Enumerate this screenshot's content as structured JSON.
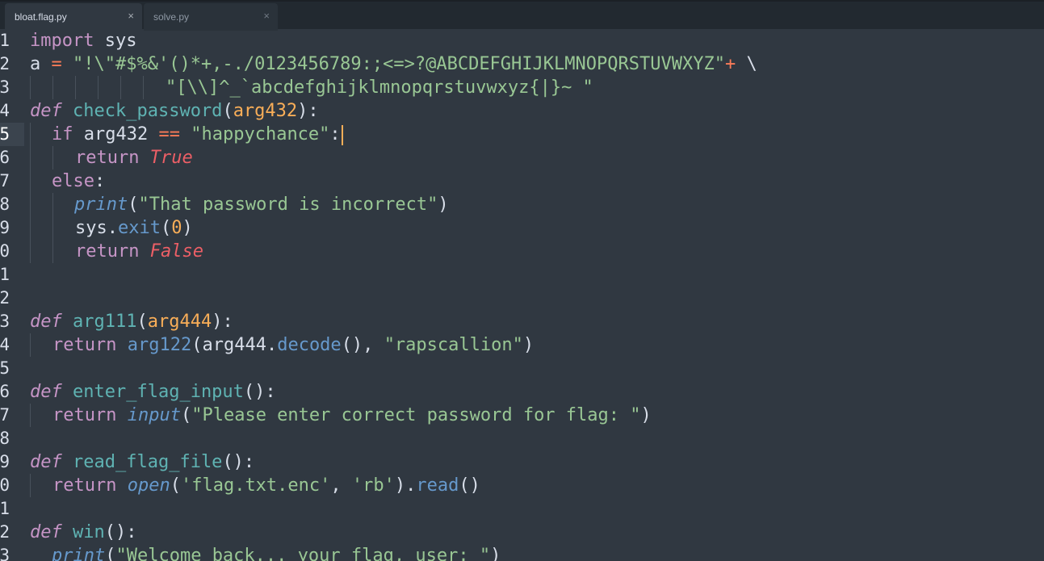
{
  "tabs": [
    {
      "label": "bloat.flag.py",
      "close": "×",
      "active": true
    },
    {
      "label": "solve.py",
      "close": "×",
      "active": false
    }
  ],
  "gutter": [
    "1",
    "2",
    "3",
    "4",
    "5",
    "6",
    "7",
    "8",
    "9",
    "0",
    "1",
    "2",
    "3",
    "4",
    "5",
    "6",
    "7",
    "8",
    "9",
    "0",
    "1",
    "2",
    "3"
  ],
  "code": {
    "l1": {
      "kw": "import",
      "rest": " sys"
    },
    "l2": {
      "a": "a",
      "eq": "=",
      "str": "\"!\\\"#$%&'()*+,-./0123456789:;<=>?@ABCDEFGHIJKLMNOPQRSTUVWXYZ\"",
      "plus": "+",
      "cont": "\\"
    },
    "l3": {
      "str": "\"[\\\\]^_`abcdefghijklmnopqrstuvwxyz{|}~ \""
    },
    "l4": {
      "def": "def",
      "name": "check_password",
      "open": "(",
      "param": "arg432",
      "close": "):"
    },
    "l5": {
      "kw": "if",
      "var": "arg432",
      "op": "==",
      "str": "\"happychance\"",
      "colon": ":"
    },
    "l6": {
      "kw": "return",
      "val": "True"
    },
    "l7": {
      "kw": "else",
      "colon": ":"
    },
    "l8": {
      "fn": "print",
      "open": "(",
      "str": "\"That password is incorrect\"",
      "close": ")"
    },
    "l9": {
      "obj": "sys",
      "dot": ".",
      "method": "exit",
      "open": "(",
      "num": "0",
      "close": ")"
    },
    "l10": {
      "kw": "return",
      "val": "False"
    },
    "l12": {
      "def": "def",
      "name": "arg111",
      "open": "(",
      "param": "arg444",
      "close": "):"
    },
    "l13": {
      "kw": "return",
      "fn": "arg122",
      "open": "(",
      "var": "arg444",
      "dot": ".",
      "method": "decode",
      "call": "(),",
      "str": "\"rapscallion\"",
      "close": ")"
    },
    "l15": {
      "def": "def",
      "name": "enter_flag_input",
      "close": "():"
    },
    "l16": {
      "kw": "return",
      "fn": "input",
      "open": "(",
      "str": "\"Please enter correct password for flag: \"",
      "close": ")"
    },
    "l18": {
      "def": "def",
      "name": "read_flag_file",
      "close": "():"
    },
    "l19": {
      "kw": "return",
      "fn": "open",
      "open": "(",
      "s1": "'flag.txt.enc'",
      "comma": ",",
      "s2": "'rb'",
      "close": ").",
      "method": "read",
      "call": "()"
    },
    "l21": {
      "def": "def",
      "name": "win",
      "close": "():"
    },
    "l22": {
      "fn": "print",
      "open": "(",
      "str": "\"Welcome back... your flag, user: \"",
      "close": ")"
    }
  },
  "colors": {
    "background": "#303841",
    "tabbar": "#222930",
    "keyword": "#c695c6",
    "function": "#5fb3b3",
    "string": "#99c794",
    "parameter": "#f9ae58",
    "operator": "#f97b58",
    "constant": "#ec5f66",
    "builtin": "#6699cc"
  }
}
